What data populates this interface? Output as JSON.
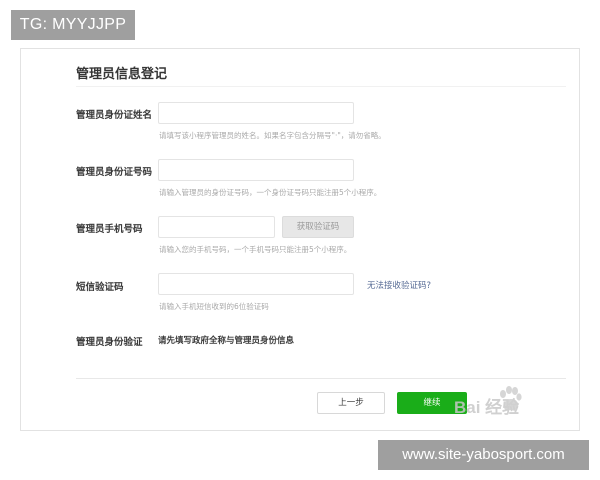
{
  "tags": {
    "top": "TG: MYYJJPP",
    "bottom": "www.site-yabosport.com"
  },
  "form": {
    "title": "管理员信息登记",
    "fields": [
      {
        "label": "管理员身份证姓名",
        "value": "",
        "hint": "请填写该小程序管理员的姓名。如果名字包含分隔号\"·\"，请勿省略。"
      },
      {
        "label": "管理员身份证号码",
        "value": "",
        "hint": "请输入管理员的身份证号码，一个身份证号码只能注册5个小程序。"
      },
      {
        "label": "管理员手机号码",
        "value": "",
        "hint": "请输入您的手机号码，一个手机号码只能注册5个小程序。",
        "button": "获取验证码"
      },
      {
        "label": "短信验证码",
        "value": "",
        "hint": "请输入手机短信收到的6位验证码",
        "link": "无法接收验证码?"
      }
    ],
    "verify": {
      "label": "管理员身份验证",
      "text": "请先填写政府全称与管理员身份信息"
    },
    "buttons": {
      "prev": "上一步",
      "next": "继续"
    }
  },
  "watermark": "Bai 经验",
  "colors": {
    "accent_green": "#1aad19",
    "link_blue": "#576b95",
    "tag_gray": "#9f9f9f"
  }
}
